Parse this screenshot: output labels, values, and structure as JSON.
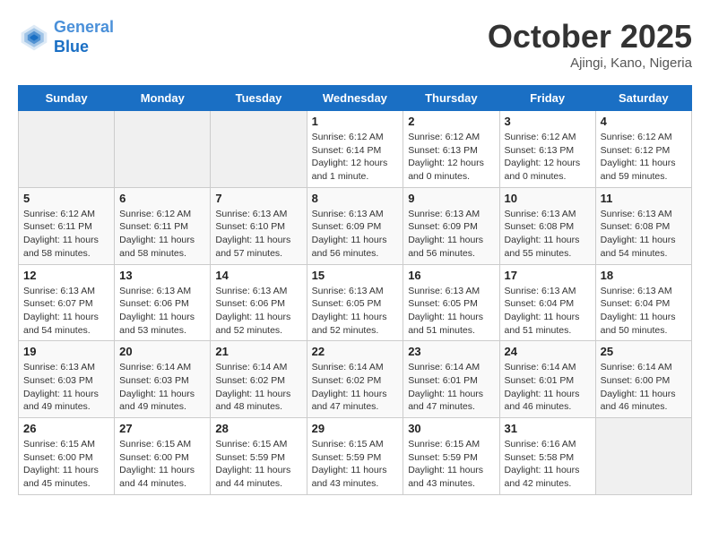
{
  "header": {
    "logo_line1": "General",
    "logo_line2": "Blue",
    "month": "October 2025",
    "location": "Ajingi, Kano, Nigeria"
  },
  "weekdays": [
    "Sunday",
    "Monday",
    "Tuesday",
    "Wednesday",
    "Thursday",
    "Friday",
    "Saturday"
  ],
  "weeks": [
    [
      {
        "day": "",
        "sunrise": "",
        "sunset": "",
        "daylight": ""
      },
      {
        "day": "",
        "sunrise": "",
        "sunset": "",
        "daylight": ""
      },
      {
        "day": "",
        "sunrise": "",
        "sunset": "",
        "daylight": ""
      },
      {
        "day": "1",
        "sunrise": "Sunrise: 6:12 AM",
        "sunset": "Sunset: 6:14 PM",
        "daylight": "Daylight: 12 hours and 1 minute."
      },
      {
        "day": "2",
        "sunrise": "Sunrise: 6:12 AM",
        "sunset": "Sunset: 6:13 PM",
        "daylight": "Daylight: 12 hours and 0 minutes."
      },
      {
        "day": "3",
        "sunrise": "Sunrise: 6:12 AM",
        "sunset": "Sunset: 6:13 PM",
        "daylight": "Daylight: 12 hours and 0 minutes."
      },
      {
        "day": "4",
        "sunrise": "Sunrise: 6:12 AM",
        "sunset": "Sunset: 6:12 PM",
        "daylight": "Daylight: 11 hours and 59 minutes."
      }
    ],
    [
      {
        "day": "5",
        "sunrise": "Sunrise: 6:12 AM",
        "sunset": "Sunset: 6:11 PM",
        "daylight": "Daylight: 11 hours and 58 minutes."
      },
      {
        "day": "6",
        "sunrise": "Sunrise: 6:12 AM",
        "sunset": "Sunset: 6:11 PM",
        "daylight": "Daylight: 11 hours and 58 minutes."
      },
      {
        "day": "7",
        "sunrise": "Sunrise: 6:13 AM",
        "sunset": "Sunset: 6:10 PM",
        "daylight": "Daylight: 11 hours and 57 minutes."
      },
      {
        "day": "8",
        "sunrise": "Sunrise: 6:13 AM",
        "sunset": "Sunset: 6:09 PM",
        "daylight": "Daylight: 11 hours and 56 minutes."
      },
      {
        "day": "9",
        "sunrise": "Sunrise: 6:13 AM",
        "sunset": "Sunset: 6:09 PM",
        "daylight": "Daylight: 11 hours and 56 minutes."
      },
      {
        "day": "10",
        "sunrise": "Sunrise: 6:13 AM",
        "sunset": "Sunset: 6:08 PM",
        "daylight": "Daylight: 11 hours and 55 minutes."
      },
      {
        "day": "11",
        "sunrise": "Sunrise: 6:13 AM",
        "sunset": "Sunset: 6:08 PM",
        "daylight": "Daylight: 11 hours and 54 minutes."
      }
    ],
    [
      {
        "day": "12",
        "sunrise": "Sunrise: 6:13 AM",
        "sunset": "Sunset: 6:07 PM",
        "daylight": "Daylight: 11 hours and 54 minutes."
      },
      {
        "day": "13",
        "sunrise": "Sunrise: 6:13 AM",
        "sunset": "Sunset: 6:06 PM",
        "daylight": "Daylight: 11 hours and 53 minutes."
      },
      {
        "day": "14",
        "sunrise": "Sunrise: 6:13 AM",
        "sunset": "Sunset: 6:06 PM",
        "daylight": "Daylight: 11 hours and 52 minutes."
      },
      {
        "day": "15",
        "sunrise": "Sunrise: 6:13 AM",
        "sunset": "Sunset: 6:05 PM",
        "daylight": "Daylight: 11 hours and 52 minutes."
      },
      {
        "day": "16",
        "sunrise": "Sunrise: 6:13 AM",
        "sunset": "Sunset: 6:05 PM",
        "daylight": "Daylight: 11 hours and 51 minutes."
      },
      {
        "day": "17",
        "sunrise": "Sunrise: 6:13 AM",
        "sunset": "Sunset: 6:04 PM",
        "daylight": "Daylight: 11 hours and 51 minutes."
      },
      {
        "day": "18",
        "sunrise": "Sunrise: 6:13 AM",
        "sunset": "Sunset: 6:04 PM",
        "daylight": "Daylight: 11 hours and 50 minutes."
      }
    ],
    [
      {
        "day": "19",
        "sunrise": "Sunrise: 6:13 AM",
        "sunset": "Sunset: 6:03 PM",
        "daylight": "Daylight: 11 hours and 49 minutes."
      },
      {
        "day": "20",
        "sunrise": "Sunrise: 6:14 AM",
        "sunset": "Sunset: 6:03 PM",
        "daylight": "Daylight: 11 hours and 49 minutes."
      },
      {
        "day": "21",
        "sunrise": "Sunrise: 6:14 AM",
        "sunset": "Sunset: 6:02 PM",
        "daylight": "Daylight: 11 hours and 48 minutes."
      },
      {
        "day": "22",
        "sunrise": "Sunrise: 6:14 AM",
        "sunset": "Sunset: 6:02 PM",
        "daylight": "Daylight: 11 hours and 47 minutes."
      },
      {
        "day": "23",
        "sunrise": "Sunrise: 6:14 AM",
        "sunset": "Sunset: 6:01 PM",
        "daylight": "Daylight: 11 hours and 47 minutes."
      },
      {
        "day": "24",
        "sunrise": "Sunrise: 6:14 AM",
        "sunset": "Sunset: 6:01 PM",
        "daylight": "Daylight: 11 hours and 46 minutes."
      },
      {
        "day": "25",
        "sunrise": "Sunrise: 6:14 AM",
        "sunset": "Sunset: 6:00 PM",
        "daylight": "Daylight: 11 hours and 46 minutes."
      }
    ],
    [
      {
        "day": "26",
        "sunrise": "Sunrise: 6:15 AM",
        "sunset": "Sunset: 6:00 PM",
        "daylight": "Daylight: 11 hours and 45 minutes."
      },
      {
        "day": "27",
        "sunrise": "Sunrise: 6:15 AM",
        "sunset": "Sunset: 6:00 PM",
        "daylight": "Daylight: 11 hours and 44 minutes."
      },
      {
        "day": "28",
        "sunrise": "Sunrise: 6:15 AM",
        "sunset": "Sunset: 5:59 PM",
        "daylight": "Daylight: 11 hours and 44 minutes."
      },
      {
        "day": "29",
        "sunrise": "Sunrise: 6:15 AM",
        "sunset": "Sunset: 5:59 PM",
        "daylight": "Daylight: 11 hours and 43 minutes."
      },
      {
        "day": "30",
        "sunrise": "Sunrise: 6:15 AM",
        "sunset": "Sunset: 5:59 PM",
        "daylight": "Daylight: 11 hours and 43 minutes."
      },
      {
        "day": "31",
        "sunrise": "Sunrise: 6:16 AM",
        "sunset": "Sunset: 5:58 PM",
        "daylight": "Daylight: 11 hours and 42 minutes."
      },
      {
        "day": "",
        "sunrise": "",
        "sunset": "",
        "daylight": ""
      }
    ]
  ]
}
